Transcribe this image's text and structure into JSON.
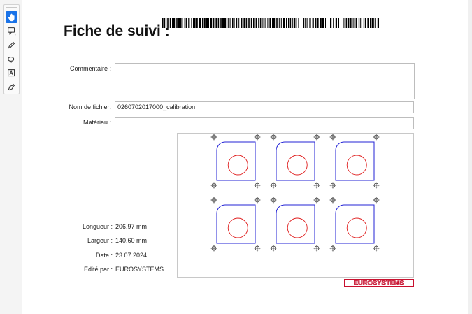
{
  "doc": {
    "title": "Fiche de suivi :",
    "comment_label": "Commentaire :",
    "comment_value": "",
    "filename_label": "Nom de fichier:",
    "filename_value": "0260702017000_calibration",
    "material_label": "Matériau :",
    "material_value": "",
    "length_label": "Longueur :",
    "length_value": "206.97 mm",
    "width_label": "Largeur :",
    "width_value": "140.60 mm",
    "date_label": "Date :",
    "date_value": "23.07.2024",
    "editor_label": "Édité par :",
    "editor_value": "EUROSYSTEMS",
    "logo_text": "EUROSYSTEMS"
  },
  "toolbar": {
    "tools": [
      "hand-pan-icon",
      "comment-add-icon",
      "pen-draw-icon",
      "eraser-icon",
      "text-box-icon",
      "fill-sign-icon"
    ]
  },
  "colors": {
    "part_outline": "#2323d6",
    "hole": "#e02020",
    "logo": "#c8102e",
    "accent": "#1a73e8"
  }
}
